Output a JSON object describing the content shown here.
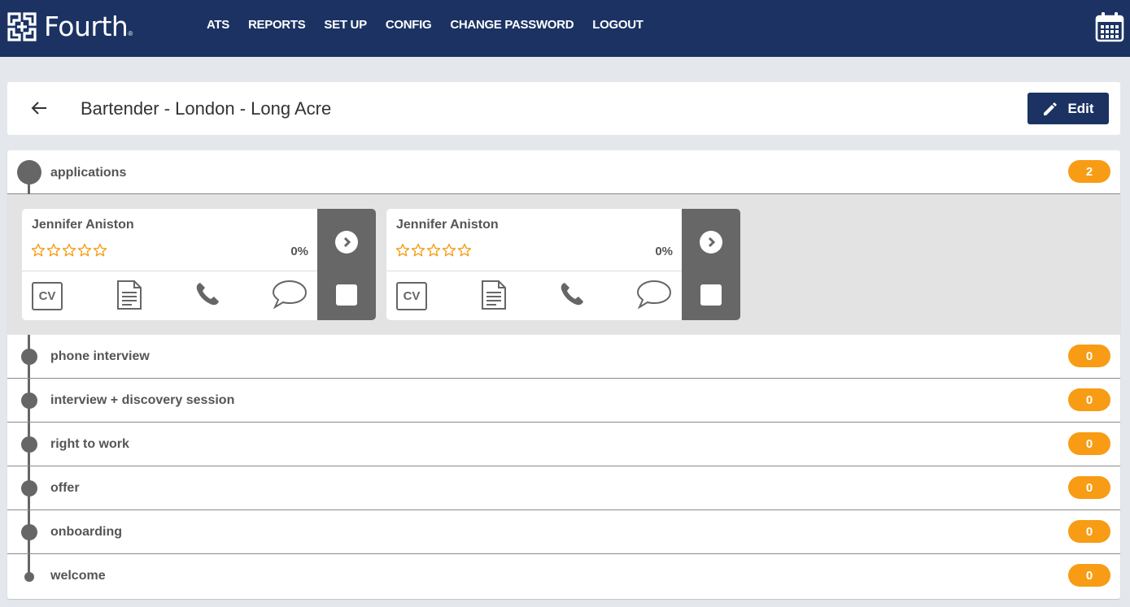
{
  "app": {
    "logo_text": "Fourth",
    "logo_mark": "®",
    "nav": [
      "ATS",
      "REPORTS",
      "SET UP",
      "CONFIG",
      "CHANGE PASSWORD",
      "LOGOUT"
    ],
    "calendar_icon": "calendar-icon",
    "colors": {
      "nav_bg": "#1b3263",
      "badge": "#f79c14",
      "timeline": "#666666"
    }
  },
  "header": {
    "title": "Bartender - London - Long Acre",
    "edit_label": "Edit"
  },
  "stages": [
    {
      "name": "applications",
      "count": "2"
    },
    {
      "name": "phone interview",
      "count": "0"
    },
    {
      "name": "interview + discovery session",
      "count": "0"
    },
    {
      "name": "right to work",
      "count": "0"
    },
    {
      "name": "offer",
      "count": "0"
    },
    {
      "name": "onboarding",
      "count": "0"
    },
    {
      "name": "welcome",
      "count": "0"
    }
  ],
  "applicants": [
    {
      "name": "Jennifer Aniston",
      "rating_stars": 0,
      "rating_max": 5,
      "score": "0%",
      "cv_label": "CV",
      "selected": false
    },
    {
      "name": "Jennifer Aniston",
      "rating_stars": 0,
      "rating_max": 5,
      "score": "0%",
      "cv_label": "CV",
      "selected": false
    }
  ]
}
